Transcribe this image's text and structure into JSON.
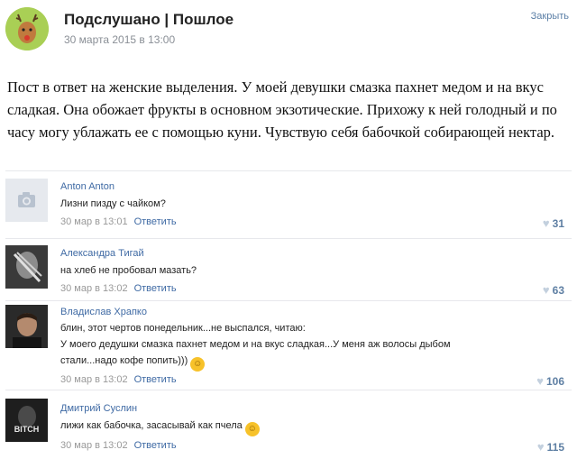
{
  "post": {
    "page_title": "Подслушано | Пошлое",
    "date": "30 марта 2015 в 13:00",
    "close_label": "Закрыть",
    "text": "Пост в ответ на женские выделения. У моей девушки смазка пахнет медом и на вкус сладкая. Она обожает фрукты в основном экзотические. Прихожу к ней голодный и по часу могу ублажать ее с помощью куни. Чувствую себя бабочкой собирающей нектар."
  },
  "reply_label": "Ответить",
  "comments": [
    {
      "author": "Anton Anton",
      "lines": [
        "Лизни пизду с чайком?"
      ],
      "time": "30 мар в 13:01",
      "likes": "31"
    },
    {
      "author": "Александра Тигай",
      "lines": [
        "на хлеб не пробовал мазать?"
      ],
      "time": "30 мар в 13:02",
      "likes": "63"
    },
    {
      "author": "Владислав Храпко",
      "lines": [
        "блин, этот чертов понедельник...не выспался, читаю:",
        "У моего дедушки смазка пахнет медом и на вкус сладкая...У меня аж волосы дыбом",
        "стали...надо кофе попить)))"
      ],
      "time": "30 мар в 13:02",
      "likes": "106"
    },
    {
      "author": "Дмитрий Суслин",
      "lines": [
        "лижи как бабочка, засасывай как пчела"
      ],
      "time": "30 мар в 13:02",
      "likes": "115",
      "avatar_text": "BITCH"
    }
  ]
}
